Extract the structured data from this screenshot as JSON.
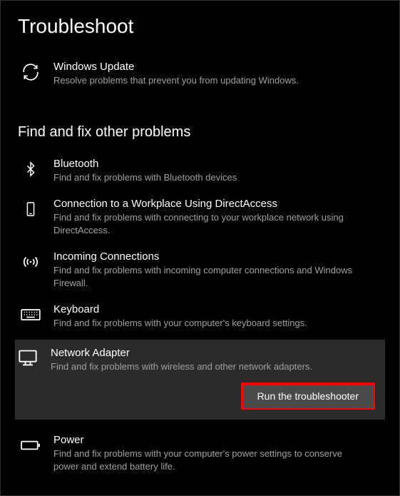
{
  "page": {
    "title": "Troubleshoot",
    "sections": {
      "findfix": {
        "title": "Find and fix other problems"
      }
    }
  },
  "items": {
    "windows_update": {
      "title": "Windows Update",
      "desc": "Resolve problems that prevent you from updating Windows."
    },
    "bluetooth": {
      "title": "Bluetooth",
      "desc": "Find and fix problems with Bluetooth devices"
    },
    "workplace": {
      "title": "Connection to a Workplace Using DirectAccess",
      "desc": "Find and fix problems with connecting to your workplace network using DirectAccess."
    },
    "incoming": {
      "title": "Incoming Connections",
      "desc": "Find and fix problems with incoming computer connections and Windows Firewall."
    },
    "keyboard": {
      "title": "Keyboard",
      "desc": "Find and fix problems with your computer's keyboard settings."
    },
    "network_adapter": {
      "title": "Network Adapter",
      "desc": "Find and fix problems with wireless and other network adapters."
    },
    "power": {
      "title": "Power",
      "desc": "Find and fix problems with your computer's power settings to conserve power and extend battery life."
    }
  },
  "buttons": {
    "run_troubleshooter": "Run the troubleshooter"
  }
}
